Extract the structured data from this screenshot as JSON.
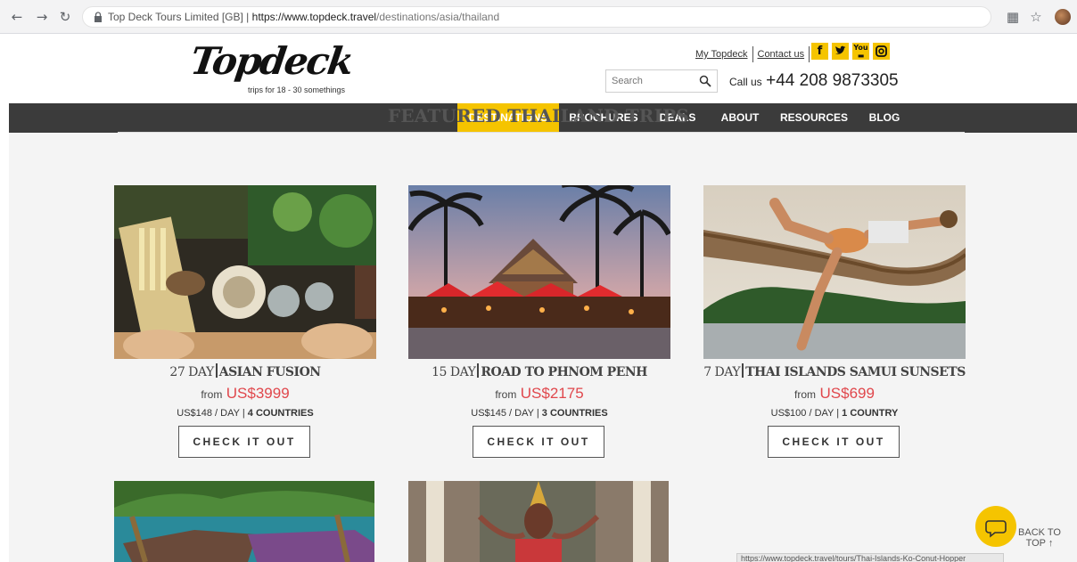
{
  "browser": {
    "site_name": "Top Deck Tours Limited [GB]",
    "url_origin": "https://www.topdeck.travel",
    "url_path": "/destinations/asia/thailand"
  },
  "header": {
    "logo_text": "Topdeck",
    "logo_tagline": "trips for 18 - 30 somethings",
    "my_topdeck": "My Topdeck",
    "contact_us": "Contact us",
    "search_placeholder": "Search",
    "call_label": "Call us",
    "phone": "+44 208 9873305"
  },
  "nav": {
    "items": [
      {
        "label": "DESTINATIONS",
        "active": true
      },
      {
        "label": "BROCHURES"
      },
      {
        "label": "DEALS"
      },
      {
        "label": "ABOUT"
      },
      {
        "label": "RESOURCES"
      },
      {
        "label": "BLOG"
      }
    ]
  },
  "section": {
    "title": "FEATURED THAILAND TRIPS"
  },
  "trips": [
    {
      "duration": "27 DAY",
      "name": "ASIAN FUSION",
      "from": "from",
      "price": "US$3999",
      "per_day": "US$148 / DAY",
      "countries": "4 COUNTRIES",
      "cta": "CHECK IT OUT"
    },
    {
      "duration": "15 DAY",
      "name": "ROAD TO PHNOM PENH",
      "from": "from",
      "price": "US$2175",
      "per_day": "US$145 / DAY",
      "countries": "3 COUNTRIES",
      "cta": "CHECK IT OUT"
    },
    {
      "duration": "7 DAY",
      "name": "THAI ISLANDS SAMUI SUNSETS",
      "from": "from",
      "price": "US$699",
      "per_day": "US$100 / DAY",
      "countries": "1 COUNTRY",
      "cta": "CHECK IT OUT"
    }
  ],
  "widgets": {
    "back_to_top": "BACK TO TOP ↑",
    "status_url": "https://www.topdeck.travel/tours/Thai-Islands-Ko-Conut-Hopper"
  },
  "colors": {
    "accent": "#f5c400",
    "nav_bg": "#3b3b3b",
    "price": "#e0474c"
  }
}
